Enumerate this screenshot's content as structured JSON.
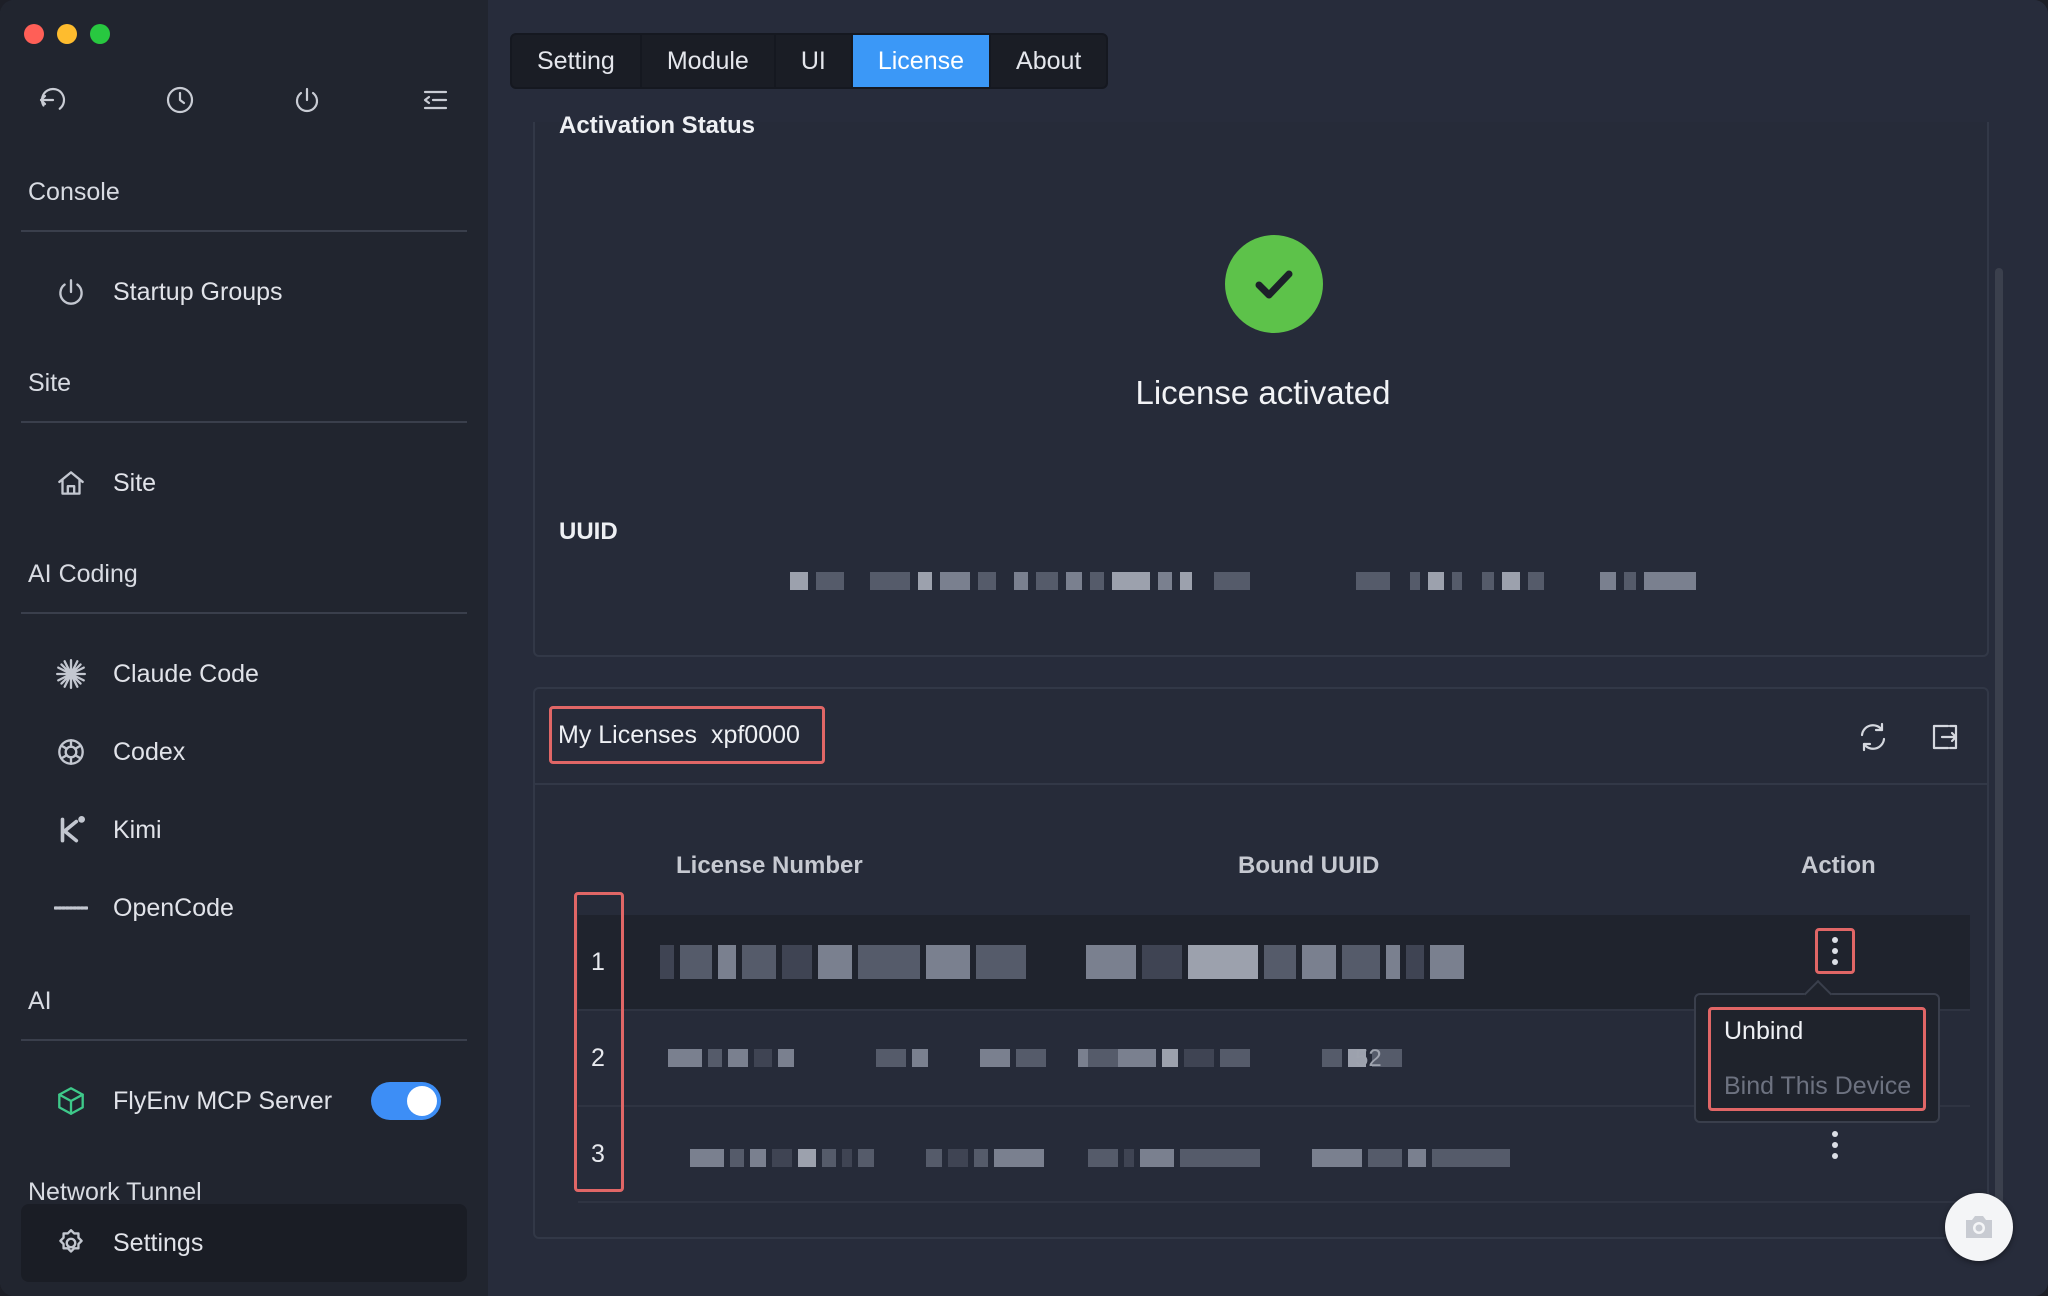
{
  "sidebar": {
    "toolbar": [
      "back-icon",
      "clock-icon",
      "power-icon",
      "menu-collapse-icon"
    ],
    "groups": {
      "console": "Console",
      "site": "Site",
      "ai_coding": "AI Coding",
      "ai": "AI",
      "network_tunnel": "Network Tunnel"
    },
    "items": {
      "startup_groups": "Startup Groups",
      "site": "Site",
      "claude_code": "Claude Code",
      "codex": "Codex",
      "kimi": "Kimi",
      "opencode": "OpenCode",
      "flyenv_mcp": "FlyEnv MCP Server",
      "settings": "Settings"
    },
    "flyenv_mcp_enabled": true
  },
  "tabs": [
    "Setting",
    "Module",
    "UI",
    "License",
    "About"
  ],
  "active_tab": "License",
  "activation": {
    "heading": "Activation Status",
    "status": "License activated",
    "uuid_label": "UUID"
  },
  "licenses": {
    "title": "My Licenses",
    "user": "xpf0000",
    "columns": {
      "license_number": "License Number",
      "bound_uuid": "Bound UUID",
      "action": "Action"
    },
    "rows": [
      {
        "index": "1"
      },
      {
        "index": "2",
        "partial_uuid": "52"
      },
      {
        "index": "3"
      }
    ]
  },
  "action_menu": {
    "unbind": "Unbind",
    "bind_device": "Bind This Device"
  },
  "colors": {
    "accent": "#3b98f7",
    "success": "#5dc24a",
    "highlight_outline": "#e06666"
  }
}
